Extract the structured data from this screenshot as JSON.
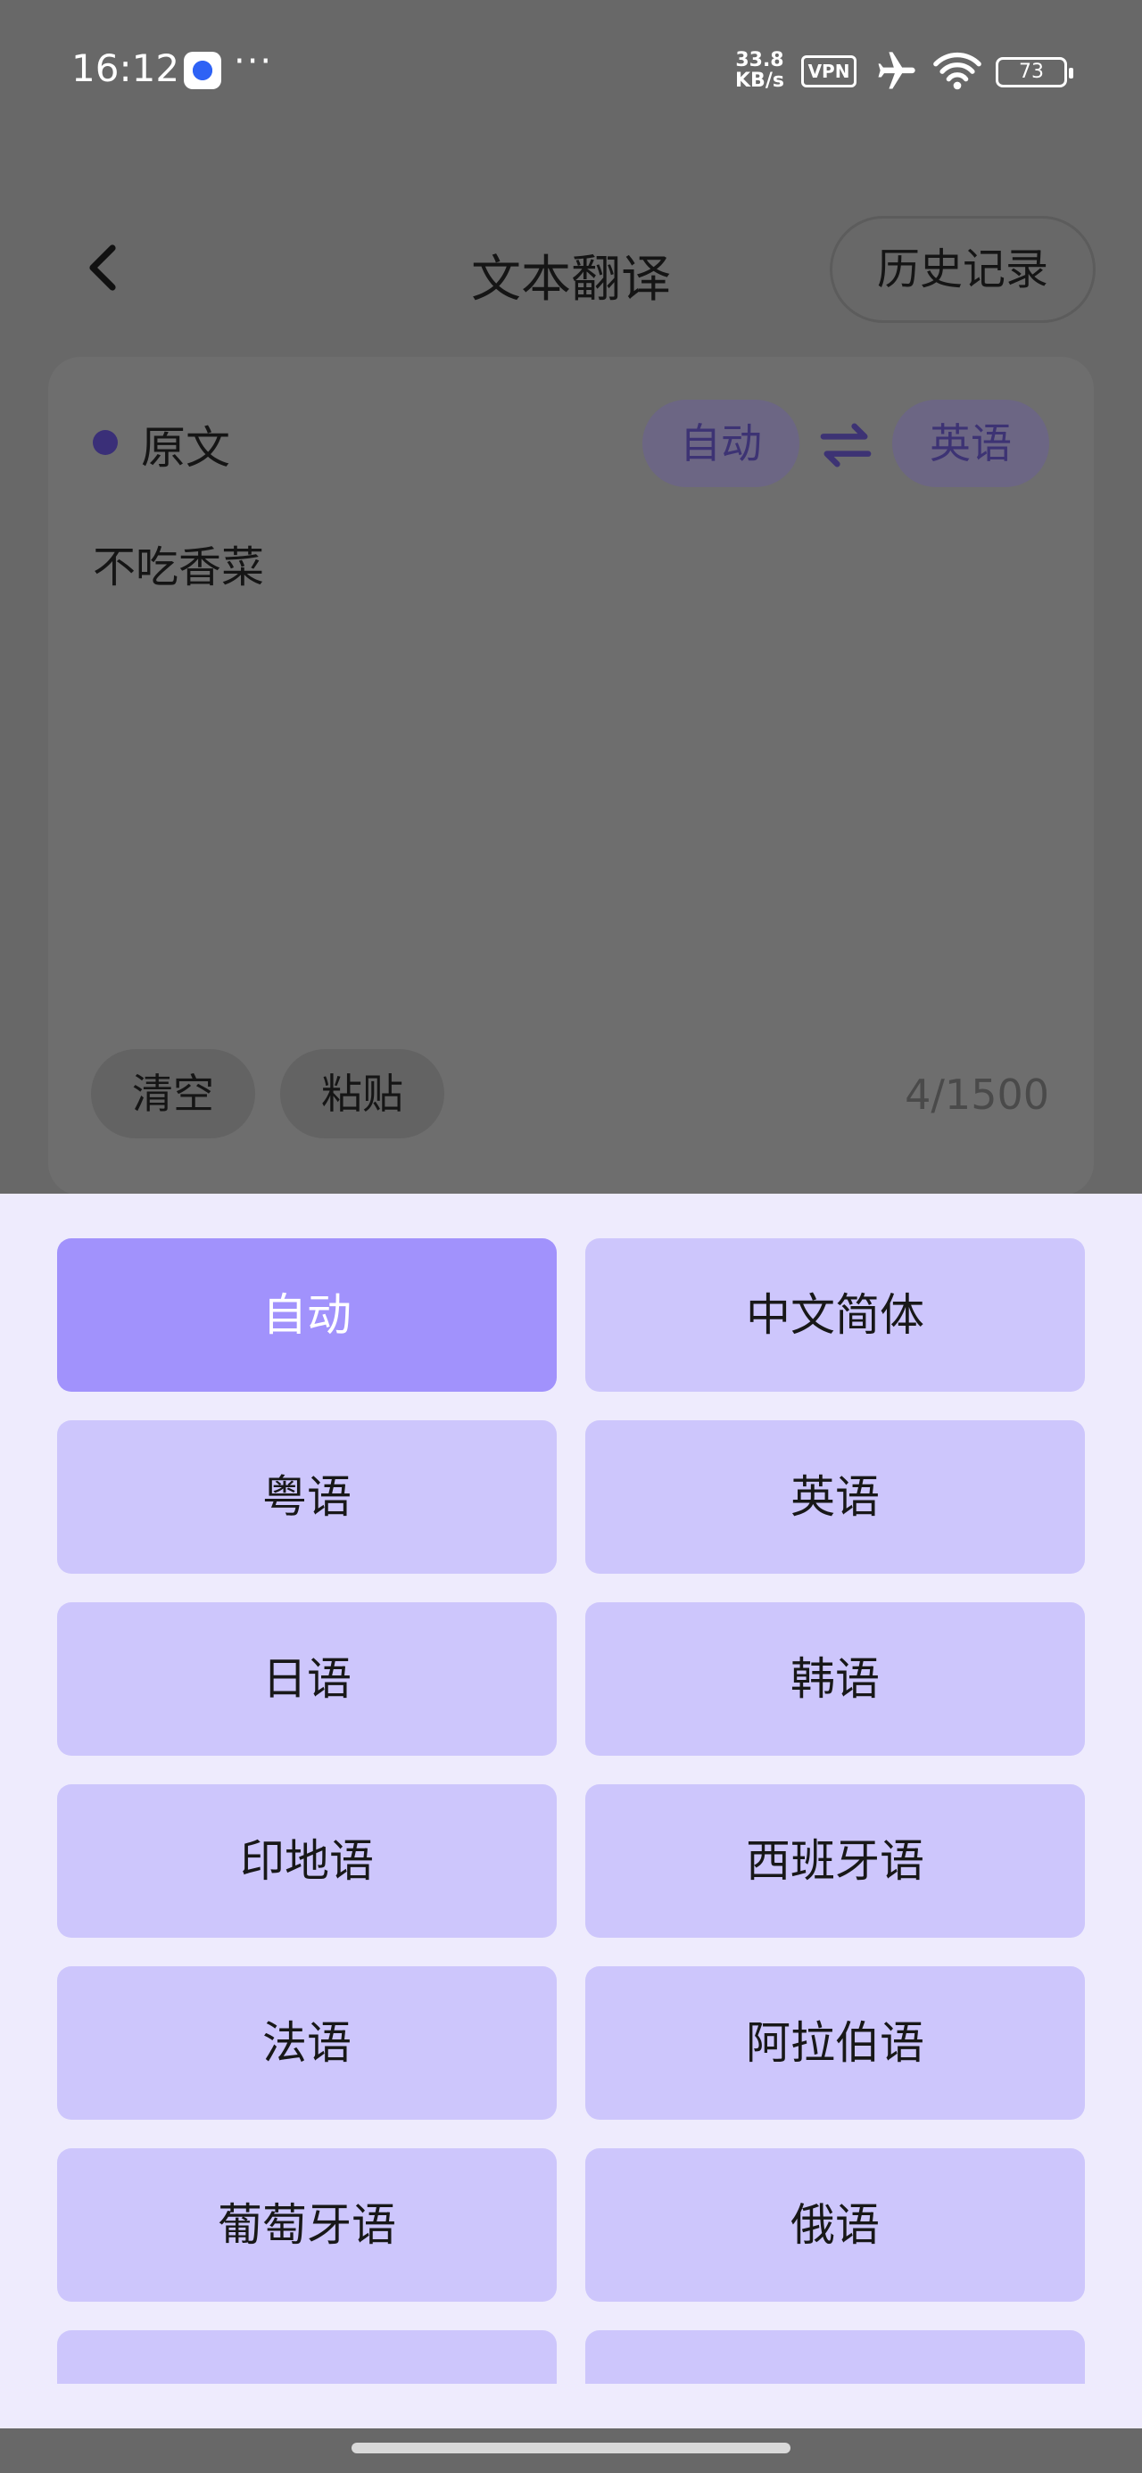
{
  "status_bar": {
    "time": "16:12",
    "more": "···",
    "net_speed_value": "33.8",
    "net_speed_unit": "KB/s",
    "vpn": "VPN",
    "battery": "73",
    "icons": [
      "app-icon",
      "airplane-icon",
      "wifi-icon",
      "battery-icon"
    ]
  },
  "header": {
    "title": "文本翻译",
    "history_button": "历史记录",
    "back_icon": "chevron-left-icon"
  },
  "source_card": {
    "label": "原文",
    "source_lang": "自动",
    "target_lang": "英语",
    "swap_icon": "swap-arrows-icon",
    "text": "不吃香菜",
    "clear_button": "清空",
    "paste_button": "粘贴",
    "char_count": "4/1500"
  },
  "language_sheet": {
    "selected": "自动",
    "options": [
      "自动",
      "中文简体",
      "粤语",
      "英语",
      "日语",
      "韩语",
      "印地语",
      "西班牙语",
      "法语",
      "阿拉伯语",
      "葡萄牙语",
      "俄语",
      "",
      ""
    ]
  },
  "colors": {
    "overlay": "#686868",
    "sheet_bg": "#eeebfd",
    "option_bg": "#cdc6fc",
    "option_selected_bg": "#a192fc",
    "accent_dot": "#3a2f78"
  }
}
